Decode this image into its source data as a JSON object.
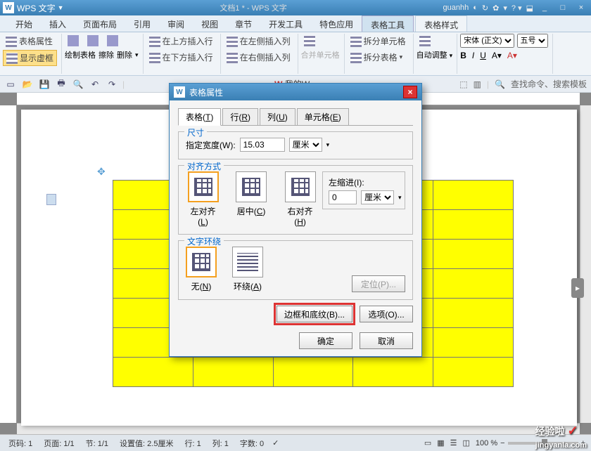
{
  "app": {
    "name": "WPS 文字",
    "doc": "文档1 * - WPS 文字",
    "user": "guanhh"
  },
  "wincontrols": [
    "_",
    "□",
    "×"
  ],
  "tabs": [
    "开始",
    "插入",
    "页面布局",
    "引用",
    "审阅",
    "视图",
    "章节",
    "开发工具",
    "特色应用",
    "表格工具",
    "表格样式"
  ],
  "active_tab": 9,
  "ribbon": {
    "props": "表格属性",
    "showgrid": "显示虚框",
    "draw": "绘制表格",
    "erase": "擦除",
    "del": "删除",
    "ins_above": "在上方插入行",
    "ins_below": "在下方插入行",
    "ins_left": "在左侧插入列",
    "ins_right": "在右侧插入列",
    "merge": "合并单元格",
    "split_cell": "拆分单元格",
    "split_tbl": "拆分表格",
    "autofit": "自动调整",
    "font_name": "宋体 (正文)",
    "font_size": "五号"
  },
  "qat_search": "查找命令、搜索模板",
  "wps_home": "我的W",
  "dialog": {
    "title": "表格属性",
    "tabs": [
      {
        "l": "表格",
        "u": "T"
      },
      {
        "l": "行",
        "u": "R"
      },
      {
        "l": "列",
        "u": "U"
      },
      {
        "l": "单元格",
        "u": "E"
      }
    ],
    "size_legend": "尺寸",
    "width_label": "指定宽度(W):",
    "width_value": "15.03",
    "width_unit": "厘米",
    "align_legend": "对齐方式",
    "align_opts": [
      {
        "l": "左对齐",
        "u": "L"
      },
      {
        "l": "居中",
        "u": "C"
      },
      {
        "l": "右对齐",
        "u": "H"
      }
    ],
    "indent_label": "左缩进(I):",
    "indent_value": "0",
    "indent_unit": "厘米",
    "wrap_legend": "文字环绕",
    "wrap_opts": [
      {
        "l": "无",
        "u": "N"
      },
      {
        "l": "环绕",
        "u": "A"
      }
    ],
    "pos_btn": "定位(P)...",
    "border_btn": "边框和底纹(B)...",
    "options_btn": "选项(O)...",
    "ok": "确定",
    "cancel": "取消"
  },
  "status": {
    "page": "页码: 1",
    "pages": "页面: 1/1",
    "section": "节: 1/1",
    "setval": "设置值: 2.5厘米",
    "row": "行: 1",
    "col": "列: 1",
    "chars": "字数: 0",
    "zoom": "100 %"
  },
  "watermark": {
    "brand": "经验啦",
    "url": "jingyanla.com"
  }
}
